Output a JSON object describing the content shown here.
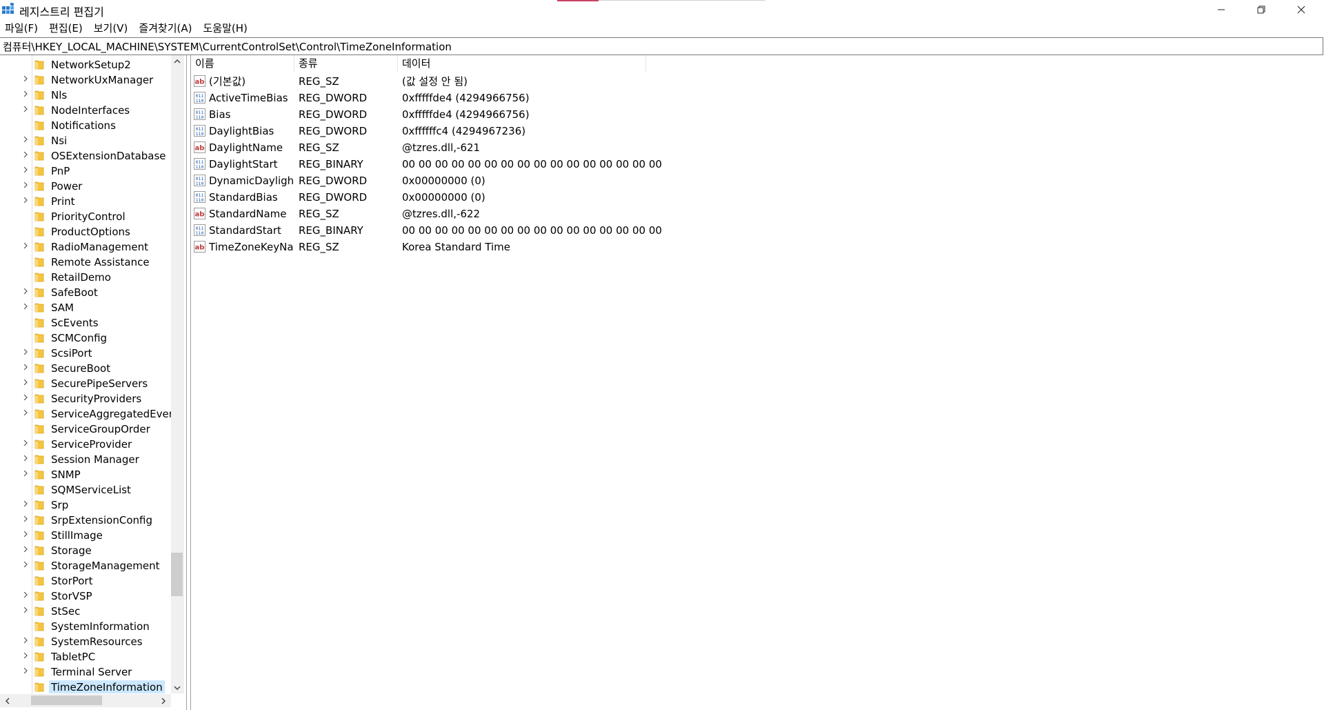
{
  "window": {
    "title": "레지스트리 편집기",
    "controls": {
      "minimize": "—",
      "maximize": "❐",
      "close": "✕"
    }
  },
  "menu": [
    {
      "label": "파일(F)"
    },
    {
      "label": "편집(E)"
    },
    {
      "label": "보기(V)"
    },
    {
      "label": "즐겨찾기(A)"
    },
    {
      "label": "도움말(H)"
    }
  ],
  "address": "컴퓨터\\HKEY_LOCAL_MACHINE\\SYSTEM\\CurrentControlSet\\Control\\TimeZoneInformation",
  "tree": [
    {
      "label": "NetworkSetup2",
      "expandable": false
    },
    {
      "label": "NetworkUxManager",
      "expandable": true
    },
    {
      "label": "Nls",
      "expandable": true
    },
    {
      "label": "NodeInterfaces",
      "expandable": true
    },
    {
      "label": "Notifications",
      "expandable": false
    },
    {
      "label": "Nsi",
      "expandable": true
    },
    {
      "label": "OSExtensionDatabase",
      "expandable": true
    },
    {
      "label": "PnP",
      "expandable": true
    },
    {
      "label": "Power",
      "expandable": true
    },
    {
      "label": "Print",
      "expandable": true
    },
    {
      "label": "PriorityControl",
      "expandable": false
    },
    {
      "label": "ProductOptions",
      "expandable": false
    },
    {
      "label": "RadioManagement",
      "expandable": true
    },
    {
      "label": "Remote Assistance",
      "expandable": false
    },
    {
      "label": "RetailDemo",
      "expandable": false
    },
    {
      "label": "SafeBoot",
      "expandable": true
    },
    {
      "label": "SAM",
      "expandable": true
    },
    {
      "label": "ScEvents",
      "expandable": false
    },
    {
      "label": "SCMConfig",
      "expandable": false
    },
    {
      "label": "ScsiPort",
      "expandable": true
    },
    {
      "label": "SecureBoot",
      "expandable": true
    },
    {
      "label": "SecurePipeServers",
      "expandable": true
    },
    {
      "label": "SecurityProviders",
      "expandable": true
    },
    {
      "label": "ServiceAggregatedEvents",
      "expandable": true
    },
    {
      "label": "ServiceGroupOrder",
      "expandable": false
    },
    {
      "label": "ServiceProvider",
      "expandable": true
    },
    {
      "label": "Session Manager",
      "expandable": true
    },
    {
      "label": "SNMP",
      "expandable": true
    },
    {
      "label": "SQMServiceList",
      "expandable": false
    },
    {
      "label": "Srp",
      "expandable": true
    },
    {
      "label": "SrpExtensionConfig",
      "expandable": true
    },
    {
      "label": "StillImage",
      "expandable": true
    },
    {
      "label": "Storage",
      "expandable": true
    },
    {
      "label": "StorageManagement",
      "expandable": true
    },
    {
      "label": "StorPort",
      "expandable": false
    },
    {
      "label": "StorVSP",
      "expandable": true
    },
    {
      "label": "StSec",
      "expandable": true
    },
    {
      "label": "SystemInformation",
      "expandable": false
    },
    {
      "label": "SystemResources",
      "expandable": true
    },
    {
      "label": "TabletPC",
      "expandable": true
    },
    {
      "label": "Terminal Server",
      "expandable": true
    },
    {
      "label": "TimeZoneInformation",
      "expandable": false,
      "selected": true
    }
  ],
  "columns": {
    "name": "이름",
    "type": "종류",
    "data": "데이터"
  },
  "values": [
    {
      "icon": "string-value-icon",
      "name": "(기본값)",
      "type": "REG_SZ",
      "data": "(값 설정 안 됨)"
    },
    {
      "icon": "binary-value-icon",
      "name": "ActiveTimeBias",
      "type": "REG_DWORD",
      "data": "0xfffffde4 (4294966756)"
    },
    {
      "icon": "binary-value-icon",
      "name": "Bias",
      "type": "REG_DWORD",
      "data": "0xfffffde4 (4294966756)"
    },
    {
      "icon": "binary-value-icon",
      "name": "DaylightBias",
      "type": "REG_DWORD",
      "data": "0xffffffc4 (4294967236)"
    },
    {
      "icon": "string-value-icon",
      "name": "DaylightName",
      "type": "REG_SZ",
      "data": "@tzres.dll,-621"
    },
    {
      "icon": "binary-value-icon",
      "name": "DaylightStart",
      "type": "REG_BINARY",
      "data": "00 00 00 00 00 00 00 00 00 00 00 00 00 00 00 00"
    },
    {
      "icon": "binary-value-icon",
      "name": "DynamicDayligh...",
      "type": "REG_DWORD",
      "data": "0x00000000 (0)"
    },
    {
      "icon": "binary-value-icon",
      "name": "StandardBias",
      "type": "REG_DWORD",
      "data": "0x00000000 (0)"
    },
    {
      "icon": "string-value-icon",
      "name": "StandardName",
      "type": "REG_SZ",
      "data": "@tzres.dll,-622"
    },
    {
      "icon": "binary-value-icon",
      "name": "StandardStart",
      "type": "REG_BINARY",
      "data": "00 00 00 00 00 00 00 00 00 00 00 00 00 00 00 00"
    },
    {
      "icon": "string-value-icon",
      "name": "TimeZoneKeyNa...",
      "type": "REG_SZ",
      "data": "Korea Standard Time"
    }
  ],
  "colors": {
    "selection": "#cce8ff",
    "accent": "#c74262",
    "folder": "#f5c542"
  },
  "scrollbars": {
    "tree_vertical_position": 0.85,
    "tree_horizontal_position": 0.25
  }
}
